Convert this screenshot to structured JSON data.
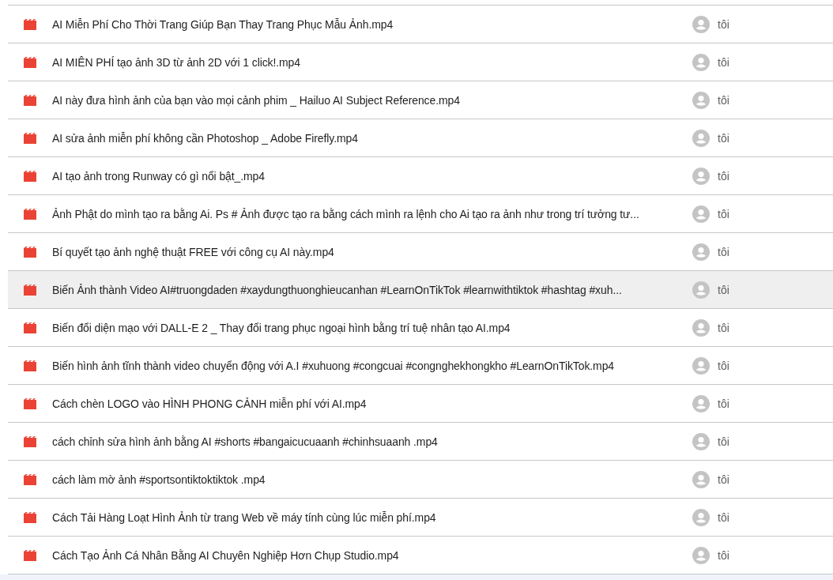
{
  "files": [
    {
      "name": "AI Miễn Phí Cho Thời Trang Giúp Bạn Thay Trang Phục Mẫu Ảnh.mp4",
      "owner": "tôi",
      "selected": false
    },
    {
      "name": "AI MIÊN PHÍ tạo ảnh 3D từ ảnh 2D với 1 click!.mp4",
      "owner": "tôi",
      "selected": false
    },
    {
      "name": "AI này đưa hình ảnh của bạn vào mọi cảnh phim _ Hailuo AI Subject Reference.mp4",
      "owner": "tôi",
      "selected": false
    },
    {
      "name": "AI sửa ảnh miễn phí không cần Photoshop _ Adobe Firefly.mp4",
      "owner": "tôi",
      "selected": false
    },
    {
      "name": "AI tạo ảnh trong Runway có gì nổi bật_.mp4",
      "owner": "tôi",
      "selected": false
    },
    {
      "name": "Ảnh Phật do mình tạo ra bằng Ai. Ps # Ảnh được tạo ra bằng cách mình ra lệnh cho Ai tạo ra ảnh như trong trí tưởng tư...",
      "owner": "tôi",
      "selected": false
    },
    {
      "name": "Bí quyết tạo ảnh nghệ thuật FREE với công cụ AI này.mp4",
      "owner": "tôi",
      "selected": false
    },
    {
      "name": "Biến Ảnh thành Video AI#truongdaden #xaydungthuonghieucanhan #LearnOnTikTok #learnwithtiktok #hashtag #xuh...",
      "owner": "tôi",
      "selected": true
    },
    {
      "name": "Biến đổi diện mạo với DALL-E 2 _ Thay đổi trang phục ngoại hình bằng trí tuệ nhân tạo AI.mp4",
      "owner": "tôi",
      "selected": false
    },
    {
      "name": "Biến hình ảnh tĩnh thành video chuyển động với A.I #xuhuong #congcuai #congnghekhongkho #LearnOnTikTok.mp4",
      "owner": "tôi",
      "selected": false
    },
    {
      "name": "Cách chèn LOGO vào HÌNH PHONG CẢNH miễn phí với AI.mp4",
      "owner": "tôi",
      "selected": false
    },
    {
      "name": "cách chỉnh sửa hình ảnh bằng AI #shorts #bangaicucuaanh #chinhsuaanh .mp4",
      "owner": "tôi",
      "selected": false
    },
    {
      "name": "cách làm mờ ảnh #sportsontiktoktiktok .mp4",
      "owner": "tôi",
      "selected": false
    },
    {
      "name": "Cách Tải Hàng Loạt Hình Ảnh từ trang Web về máy tính cùng lúc miễn phí.mp4",
      "owner": "tôi",
      "selected": false
    },
    {
      "name": "Cách Tạo Ảnh Cá Nhân Bằng AI Chuyên Nghiệp Hơn Chụp Studio.mp4",
      "owner": "tôi",
      "selected": false
    }
  ]
}
